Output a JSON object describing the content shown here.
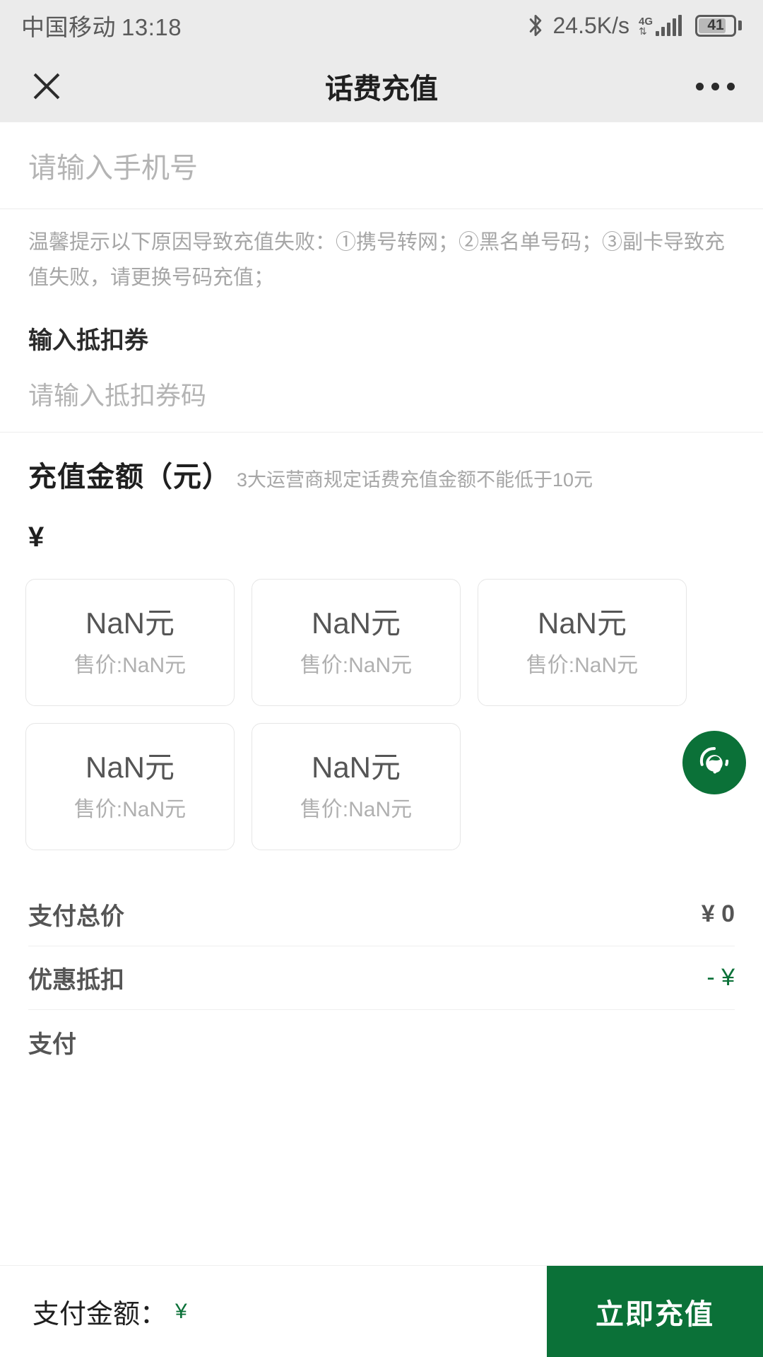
{
  "statusbar": {
    "carrier": "中国移动",
    "time": "13:18",
    "network_speed": "24.5K/s",
    "network_type": "4G",
    "battery_level": "41",
    "bluetooth_icon": "bluetooth-icon",
    "signal_icon": "signal-bars-icon",
    "battery_icon": "battery-icon"
  },
  "navbar": {
    "title": "话费充值",
    "close_icon": "close-icon",
    "more_icon": "more-options-icon"
  },
  "phone_field": {
    "placeholder": "请输入手机号",
    "value": ""
  },
  "tip": {
    "text": "温馨提示以下原因导致充值失败：①携号转网；②黑名单号码；③副卡导致充值失败，请更换号码充值；"
  },
  "coupon": {
    "section_title": "输入抵扣券",
    "placeholder": "请输入抵扣券码",
    "value": ""
  },
  "amount": {
    "title": "充值金额（元）",
    "hint": "3大运营商规定话费充值金额不能低于10元",
    "currency_symbol": "¥",
    "input_value": "",
    "input_placeholder": ""
  },
  "cards": [
    {
      "face": "NaN元",
      "sale": "售价:NaN元"
    },
    {
      "face": "NaN元",
      "sale": "售价:NaN元"
    },
    {
      "face": "NaN元",
      "sale": "售价:NaN元"
    },
    {
      "face": "NaN元",
      "sale": "售价:NaN元"
    },
    {
      "face": "NaN元",
      "sale": "售价:NaN元"
    }
  ],
  "summary": [
    {
      "label": "支付总价",
      "value": "¥ 0",
      "green": false
    },
    {
      "label": "优惠抵扣",
      "value": "- ¥",
      "green": true
    },
    {
      "label": "支付",
      "value": "",
      "green": false
    }
  ],
  "bottombar": {
    "pay_label": "支付金额：",
    "pay_currency": "¥",
    "pay_value": "",
    "button_label": "立即充值"
  },
  "fab": {
    "icon": "customer-service-headset-icon"
  },
  "colors": {
    "brand_green": "#0b7138",
    "status_bg": "#ebebeb",
    "muted_text": "#a6a6a6"
  }
}
